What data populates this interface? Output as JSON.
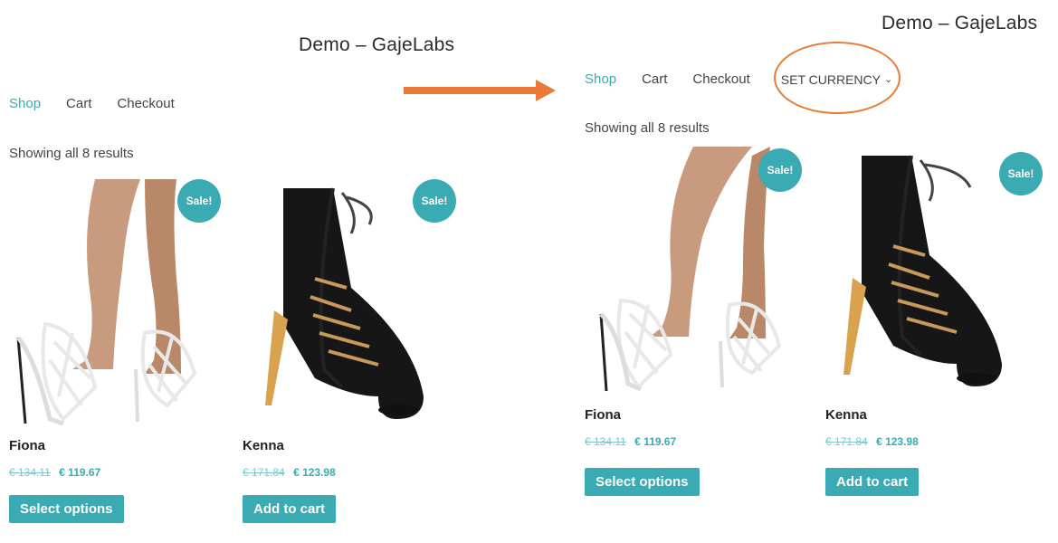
{
  "left": {
    "site_title": "Demo – GajeLabs",
    "nav": [
      "Shop",
      "Cart",
      "Checkout"
    ],
    "results": "Showing all 8 results",
    "products": [
      {
        "name": "Fiona",
        "old_price": "€ 134.11",
        "new_price": "€ 119.67",
        "button": "Select options",
        "badge": "Sale!"
      },
      {
        "name": "Kenna",
        "old_price": "€ 171.84",
        "new_price": "€ 123.98",
        "button": "Add to cart",
        "badge": "Sale!"
      }
    ]
  },
  "right": {
    "site_title": "Demo – GajeLabs",
    "nav": [
      "Shop",
      "Cart",
      "Checkout"
    ],
    "currency_menu": "SET CURRENCY",
    "results": "Showing all 8 results",
    "products": [
      {
        "name": "Fiona",
        "old_price": "€ 134.11",
        "new_price": "€ 119.67",
        "button": "Select options",
        "badge": "Sale!"
      },
      {
        "name": "Kenna",
        "old_price": "€ 171.84",
        "new_price": "€ 123.98",
        "button": "Add to cart",
        "badge": "Sale!"
      }
    ]
  },
  "icons": {
    "arrow": "arrow-right-icon",
    "chevron": "chevron-down-icon"
  },
  "colors": {
    "accent": "#3aaab3",
    "highlight": "#e77b37"
  }
}
